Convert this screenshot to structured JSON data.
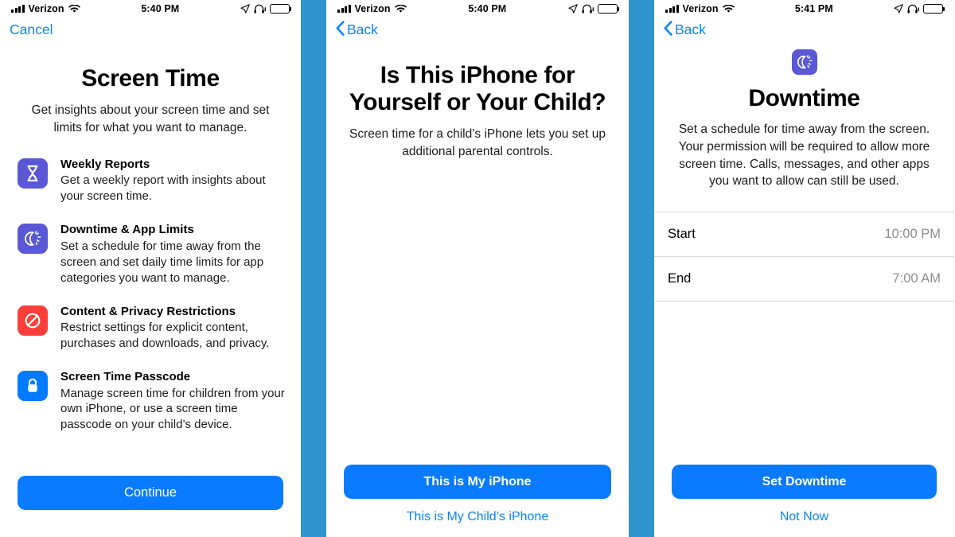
{
  "panels": [
    {
      "status": {
        "carrier": "Verizon",
        "time": "5:40 PM",
        "wifi_icon": "wifi-icon",
        "location_icon": "location-arrow-icon",
        "headphones_icon": "headphones-icon",
        "battery_icon": "battery-icon"
      },
      "nav": {
        "label": "Cancel",
        "has_chevron": false
      },
      "title": "Screen Time",
      "subtitle": "Get insights about your screen time and set limits for what you want to manage.",
      "features": [
        {
          "icon": "hourglass-icon",
          "color": "#5b58d6",
          "name": "Weekly Reports",
          "desc": "Get a weekly report with insights about your screen time."
        },
        {
          "icon": "downtime-moon-icon",
          "color": "#5b58d6",
          "name": "Downtime & App Limits",
          "desc": "Set a schedule for time away from the screen and set daily time limits for app categories you want to manage."
        },
        {
          "icon": "no-entry-icon",
          "color": "#fc3d39",
          "name": "Content & Privacy Restrictions",
          "desc": "Restrict settings for explicit content, purchases and downloads, and privacy."
        },
        {
          "icon": "lock-icon",
          "color": "#007aff",
          "name": "Screen Time Passcode",
          "desc": "Manage screen time for children from your own iPhone, or use a screen time passcode on your child’s device."
        }
      ],
      "primary_button": "Continue",
      "secondary_button": null
    },
    {
      "status": {
        "carrier": "Verizon",
        "time": "5:40 PM",
        "wifi_icon": "wifi-icon",
        "location_icon": "location-arrow-icon",
        "headphones_icon": "headphones-icon",
        "battery_icon": "battery-icon"
      },
      "nav": {
        "label": "Back",
        "has_chevron": true
      },
      "title": "Is This iPhone for Yourself or Your Child?",
      "subtitle": "Screen time for a child’s iPhone lets you set up additional parental controls.",
      "primary_button": "This is My iPhone",
      "secondary_button": "This is My Child’s iPhone"
    },
    {
      "status": {
        "carrier": "Verizon",
        "time": "5:41 PM",
        "wifi_icon": "wifi-icon",
        "location_icon": "location-arrow-icon",
        "headphones_icon": "headphones-icon",
        "battery_icon": "battery-icon"
      },
      "nav": {
        "label": "Back",
        "has_chevron": true
      },
      "hero_icon": "downtime-moon-icon",
      "hero_icon_color": "#5b58d6",
      "title": "Downtime",
      "subtitle": "Set a schedule for time away from the screen. Your permission will be required to allow more screen time. Calls, messages, and other apps you want to allow can still be used.",
      "rows": [
        {
          "label": "Start",
          "value": "10:00 PM"
        },
        {
          "label": "End",
          "value": "7:00 AM"
        }
      ],
      "primary_button": "Set Downtime",
      "secondary_button": "Not Now"
    }
  ],
  "theme": {
    "accent_blue": "#0a7bff",
    "link_blue": "#0a84ff",
    "divider_blue": "#2e95ce",
    "muted_gray": "#8e8e93",
    "separator": "#d6d6da"
  }
}
